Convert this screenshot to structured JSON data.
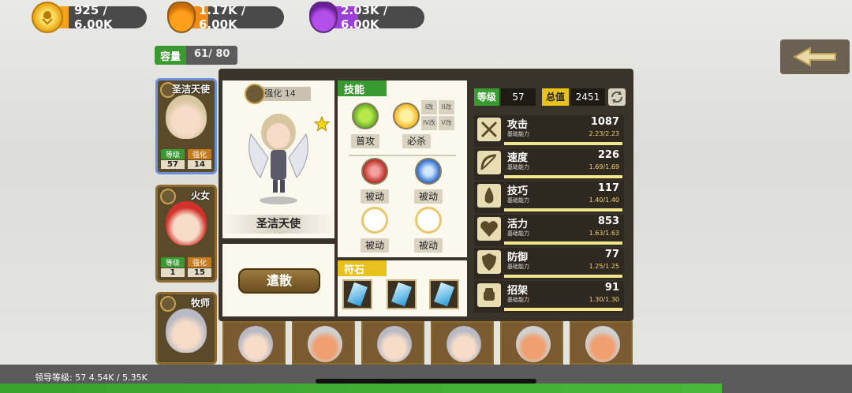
{
  "resources": [
    {
      "value": "925 / 6.00K",
      "fill": 0.15,
      "color": "#f4a21b",
      "icon": "gold-coin-icon"
    },
    {
      "value": "1.17K / 6.00K",
      "fill": 0.2,
      "color": "#f28a14",
      "icon": "orange-potion-icon"
    },
    {
      "value": "2.03K / 6.00K",
      "fill": 0.34,
      "color": "#9c3ed8",
      "icon": "purple-potion-icon"
    }
  ],
  "capacity": {
    "label": "容量",
    "value": "61/ 80"
  },
  "heroes": [
    {
      "name": "圣洁天使",
      "level_label": "等级",
      "level": "57",
      "enhance_label": "强化",
      "enhance": "14",
      "hair": "#d8c6a0"
    },
    {
      "name": "火女",
      "level_label": "等级",
      "level": "1",
      "enhance_label": "强化",
      "enhance": "15",
      "hair": "#d2322a"
    },
    {
      "name": "牧师",
      "level_label": "",
      "level": "",
      "enhance_label": "",
      "enhance": "",
      "hair": "#b9b9c4"
    }
  ],
  "detail": {
    "enhance_tag": "强化 14",
    "hero_name": "圣洁天使",
    "dismiss": "遣散",
    "skills_title": "技能",
    "skill_normal": "普攻",
    "skill_ultimate": "必杀",
    "ult_upgrades": [
      "I改",
      "II改",
      "IV改",
      "V改"
    ],
    "passive": "被动",
    "rune_title": "符石"
  },
  "summary": {
    "level_label": "等级",
    "level": "57",
    "total_label": "总值",
    "total": "2451"
  },
  "stats": [
    {
      "name": "攻击",
      "sub": "基础能力",
      "value": "1087",
      "ratio": "2.23/2.23",
      "icon": "attack-swords-icon"
    },
    {
      "name": "速度",
      "sub": "基础能力",
      "value": "226",
      "ratio": "1.69/1.69",
      "icon": "speed-bow-icon"
    },
    {
      "name": "技巧",
      "sub": "基础能力",
      "value": "117",
      "ratio": "1.40/1.40",
      "icon": "skill-flame-icon"
    },
    {
      "name": "活力",
      "sub": "基础能力",
      "value": "853",
      "ratio": "1.63/1.63",
      "icon": "vitality-heart-icon"
    },
    {
      "name": "防御",
      "sub": "基础能力",
      "value": "77",
      "ratio": "1.25/1.25",
      "icon": "defense-shield-icon"
    },
    {
      "name": "招架",
      "sub": "基础能力",
      "value": "91",
      "ratio": "1.30/1.30",
      "icon": "parry-fist-icon"
    }
  ],
  "footer": {
    "leader": "领导等级: 57  4.54K / 5.35K"
  }
}
